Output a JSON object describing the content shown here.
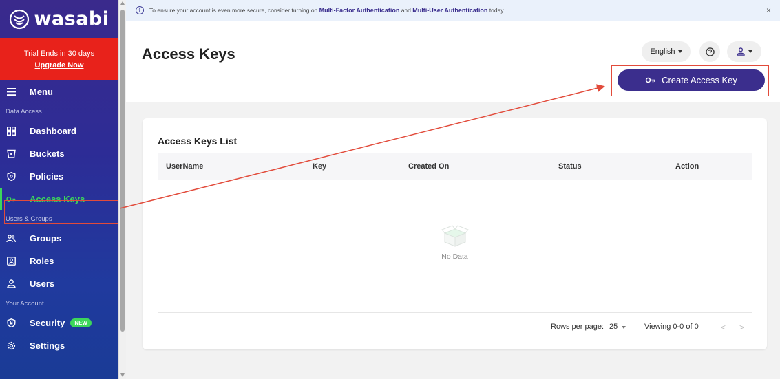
{
  "sidebar": {
    "logo_text": "wasabi",
    "trial_text": "Trial Ends in 30 days",
    "upgrade_label": "Upgrade Now",
    "menu_label": "Menu",
    "sections": {
      "data_access": "Data Access",
      "users_groups": "Users & Groups",
      "your_account": "Your Account"
    },
    "items": {
      "dashboard": "Dashboard",
      "buckets": "Buckets",
      "policies": "Policies",
      "access_keys": "Access Keys",
      "groups": "Groups",
      "roles": "Roles",
      "users": "Users",
      "security": "Security",
      "security_badge": "NEW",
      "settings": "Settings"
    }
  },
  "banner": {
    "text_1": "To ensure your account is even more secure, consider turning on",
    "link_1": "Multi-Factor Authentication",
    "text_2": "and",
    "link_2": "Multi-User Authentication",
    "text_3": "today.",
    "close": "×"
  },
  "header": {
    "title": "Access Keys",
    "language": "English",
    "create_label": "Create Access Key"
  },
  "card": {
    "title": "Access Keys List",
    "columns": [
      "UserName",
      "Key",
      "Created On",
      "Status",
      "Action"
    ],
    "empty_text": "No Data",
    "rows_per_page_label": "Rows per page:",
    "rows_per_page_value": "25",
    "viewing": "Viewing 0-0 of 0",
    "prev": "<",
    "next": ">"
  },
  "colors": {
    "brand_purple": "#3b2e8d",
    "trial_red": "#e8221b",
    "active_green": "#3cd65a",
    "highlight_red": "#e24b3b"
  }
}
